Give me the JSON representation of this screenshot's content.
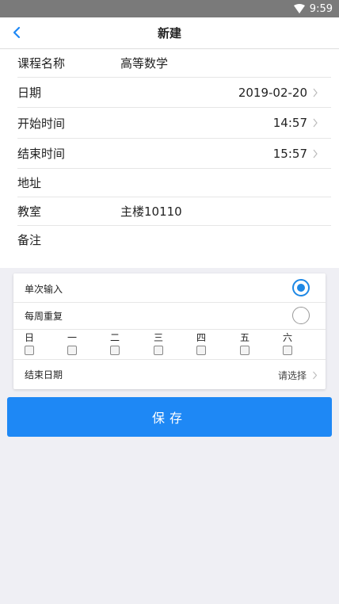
{
  "status_bar": {
    "time": "9:59",
    "wifi_icon": "wifi-icon"
  },
  "nav": {
    "back_icon": "chevron-left-icon",
    "title": "新建"
  },
  "form": {
    "course_name": {
      "label": "课程名称",
      "value": "高等数学"
    },
    "date": {
      "label": "日期",
      "value": "2019-02-20"
    },
    "start_time": {
      "label": "开始时间",
      "value": "14:57"
    },
    "end_time": {
      "label": "结束时间",
      "value": "15:57"
    },
    "address": {
      "label": "地址",
      "value": ""
    },
    "classroom": {
      "label": "教室",
      "value": "主楼10110"
    },
    "notes": {
      "label": "备注",
      "value": ""
    }
  },
  "repeat": {
    "single": {
      "label": "单次输入",
      "checked": true
    },
    "weekly": {
      "label": "每周重复",
      "checked": false
    },
    "weekdays": [
      "日",
      "一",
      "二",
      "三",
      "四",
      "五",
      "六"
    ],
    "end_date": {
      "label": "结束日期",
      "value": "请选择"
    }
  },
  "save_label": "保存",
  "colors": {
    "accent": "#1e88f5",
    "status_bar": "#7a7a7a",
    "background": "#efeff4"
  }
}
